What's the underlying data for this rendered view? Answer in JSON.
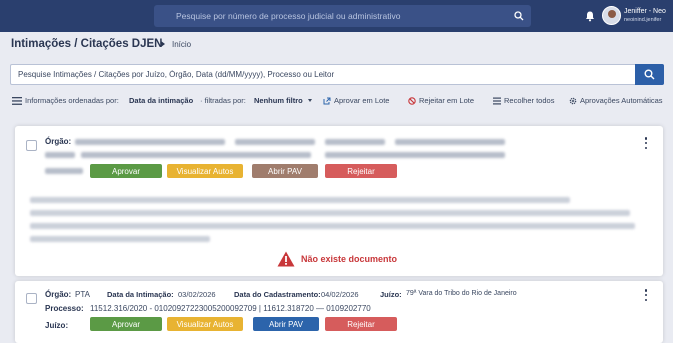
{
  "header": {
    "search_placeholder": "Pesquise por número de processo judicial ou administrativo",
    "user_name": "Jeniffer - Neo",
    "user_login": "neoinind.jenifer"
  },
  "page": {
    "title": "Intimações / Citações DJEN",
    "breadcrumb": "Início"
  },
  "main_search": {
    "placeholder": "Pesquise Intimações / Citações por Juízo, Órgão, Data (dd/MM/yyyy), Processo ou Leitor"
  },
  "filter_bar": {
    "ordered_prefix": "Informações ordenadas por:",
    "ordered_value": "Data da intimação",
    "filtered_prefix": "· filtradas por:",
    "filtered_value": "Nenhum filtro",
    "approve_batch": "Aprovar em Lote",
    "reject_batch": "Rejeitar em Lote",
    "collapse_all": "Recolher todos",
    "auto_approvals": "Aprovações Automáticas"
  },
  "card1": {
    "orgao_label": "Órgão:",
    "buttons": {
      "approve": "Aprovar",
      "view": "Visualizar Autos",
      "open_pav": "Abrir PAV",
      "reject": "Rejeitar"
    },
    "no_document": "Não existe documento"
  },
  "card2": {
    "orgao_label": "Órgão:",
    "orgao_value": "PTA",
    "intimacao_label": "Data da Intimação:",
    "intimacao_value": "03/02/2026",
    "cadastro_label": "Data do Cadastramento:",
    "cadastro_value": "04/02/2026",
    "juizo_label": "Juízo:",
    "juizo_value": "79ª Vara do Tribo do Rio de Janeiro",
    "processo_label": "Processo:",
    "processo_value": "11512.316/2020 - 01020927223005200092709 | 11612.318720 — 0109202770",
    "juizo2_label": "Juízo:",
    "buttons": {
      "approve": "Aprovar",
      "view": "Visualizar Autos",
      "open_pav": "Abrir PAV",
      "reject": "Rejeitar"
    }
  },
  "colors": {
    "topbar": "#2a3f6e",
    "approve": "#5b9a45",
    "view": "#e8b332",
    "pav_card1": "#a07d6d",
    "pav_card2": "#2c64ab",
    "reject": "#d65c5c",
    "warning": "#c8373a"
  }
}
